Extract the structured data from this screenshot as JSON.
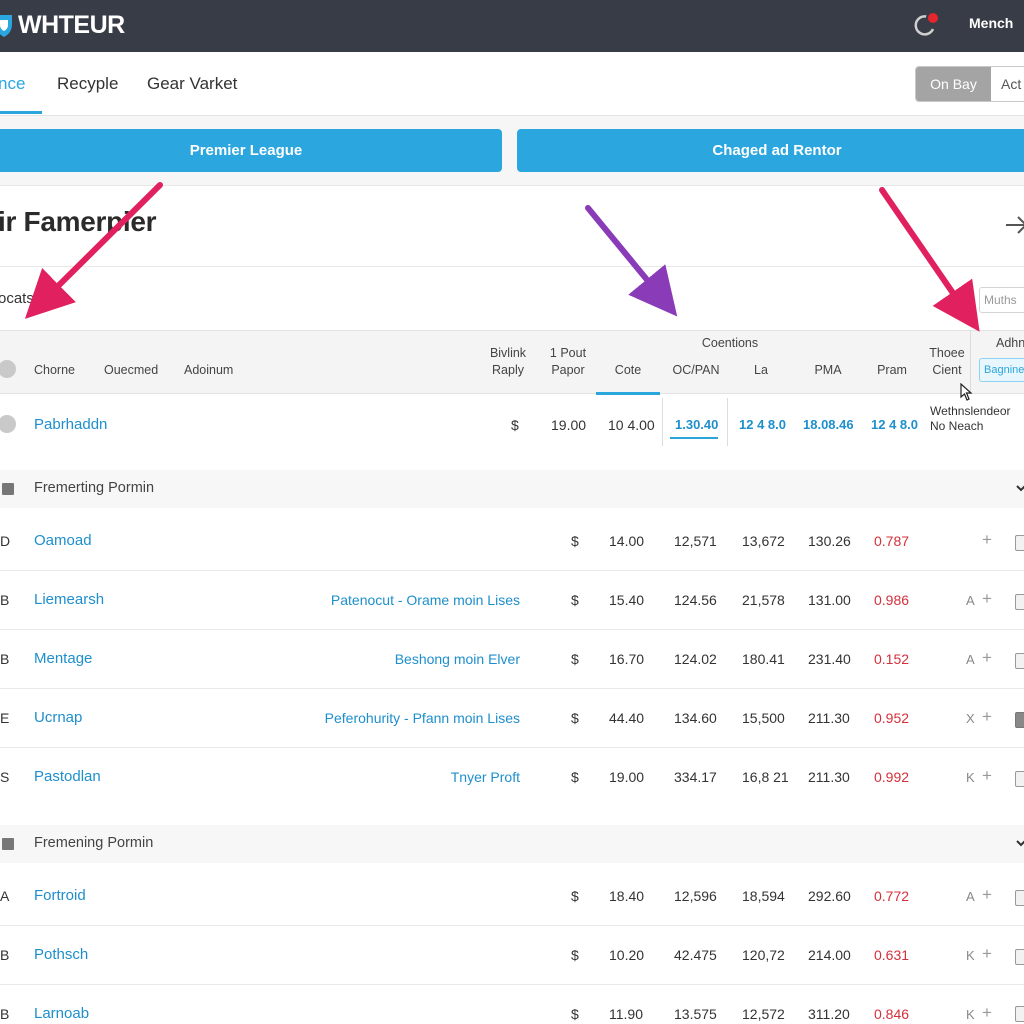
{
  "header": {
    "logo_text": "WHTEUR",
    "menu_label": "Mench"
  },
  "tabs": [
    {
      "label": "nce",
      "active": true
    },
    {
      "label": "Recyple",
      "active": false
    },
    {
      "label": "Gear Varket",
      "active": false
    }
  ],
  "segment": {
    "selected": "On Bay",
    "other": "Act"
  },
  "filters": {
    "left_button": "Premier League",
    "right_button": "Chaged ad Rentor"
  },
  "section": {
    "title": "ir Famerpier"
  },
  "search": {
    "label": "ocats",
    "placeholder": "Muths"
  },
  "table": {
    "group_header": "Coentions",
    "columns": {
      "c1": "Chorne",
      "c2": "Ouecmed",
      "c3": "Adoinum",
      "c4a": "Bivlink",
      "c4b": "Raply",
      "c5a": "1 Pout",
      "c5b": "Papor",
      "c6": "Cote",
      "c7": "OC/PAN",
      "c8": "La",
      "c9": "PMA",
      "c10": "Pram",
      "c11a": "Thoee",
      "c11b": "Cient",
      "c12": "Adhni",
      "c12_input": "Bagnine"
    },
    "summary": {
      "name": "Pabrhaddn",
      "currency": "$",
      "v1": "19.00",
      "v2": "10 4.00",
      "v3": "1.30.40",
      "v4": "12 4 8.0",
      "v5": "18.08.46",
      "v6": "12 4 8.0",
      "note1": "Wethnslendeor",
      "note2": "No Neach"
    },
    "groups": [
      {
        "label": "Fremerting Pormin",
        "rows": [
          {
            "letter": "D",
            "name": "Oamoad",
            "desc": "",
            "currency": "$",
            "v1": "14.00",
            "v2": "12,571",
            "v3": "13,672",
            "v4": "130.26",
            "v5": "0.787",
            "act": ""
          },
          {
            "letter": "B",
            "name": "Liemearsh",
            "desc": "Patenocut - Orame moin Lises",
            "currency": "$",
            "v1": "15.40",
            "v2": "124.56",
            "v3": "21,578",
            "v4": "131.00",
            "v5": "0.986",
            "act": "A"
          },
          {
            "letter": "B",
            "name": "Mentage",
            "desc": "Beshong moin Elver",
            "currency": "$",
            "v1": "16.70",
            "v2": "124.02",
            "v3": "180.41",
            "v4": "231.40",
            "v5": "0.152",
            "act": "A"
          },
          {
            "letter": "E",
            "name": "Ucrnap",
            "desc": "Peferohurity - Pfann moin Lises",
            "currency": "$",
            "v1": "44.40",
            "v2": "134.60",
            "v3": "15,500",
            "v4": "211.30",
            "v5": "0.952",
            "act": "X"
          },
          {
            "letter": "S",
            "name": "Pastodlan",
            "desc": "Tnyer Proft",
            "currency": "$",
            "v1": "19.00",
            "v2": "334.17",
            "v3": "16,8 21",
            "v4": "211.30",
            "v5": "0.992",
            "act": "K"
          }
        ]
      },
      {
        "label": "Fremening Pormin",
        "rows": [
          {
            "letter": "A",
            "name": "Fortroid",
            "desc": "",
            "currency": "$",
            "v1": "18.40",
            "v2": "12,596",
            "v3": "18,594",
            "v4": "292.60",
            "v5": "0.772",
            "act": "A"
          },
          {
            "letter": "B",
            "name": "Pothsch",
            "desc": "",
            "currency": "$",
            "v1": "10.20",
            "v2": "42.475",
            "v3": "120,72",
            "v4": "214.00",
            "v5": "0.631",
            "act": "K"
          },
          {
            "letter": "B",
            "name": "Larnoab",
            "desc": "",
            "currency": "$",
            "v1": "11.90",
            "v2": "13.575",
            "v3": "12,572",
            "v4": "311.20",
            "v5": "0.846",
            "act": "K"
          }
        ]
      }
    ]
  },
  "colors": {
    "topbar": "#383c46",
    "accent": "#2ba6df",
    "negative": "#d3303b",
    "arrow_pink": "#e0205f",
    "arrow_purple": "#8a3bb8"
  }
}
